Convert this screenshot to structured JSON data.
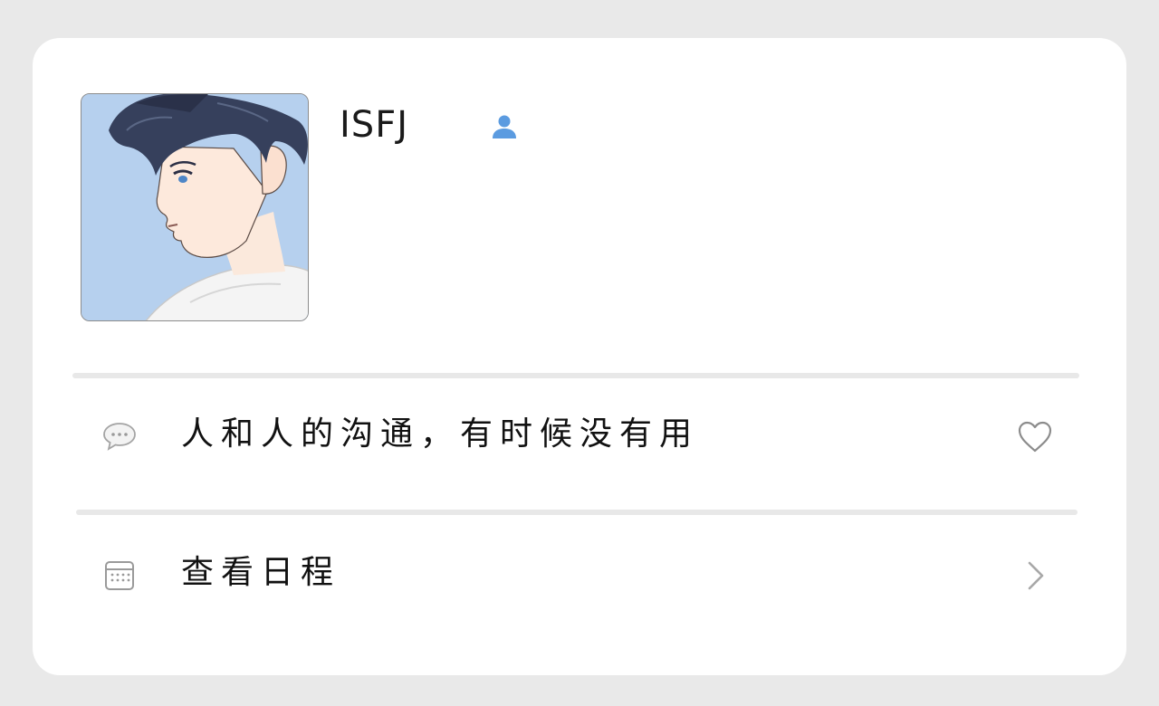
{
  "profile": {
    "name": "ISFJ",
    "avatar_icon": "anime-boy-avatar",
    "gender_icon": "person-icon",
    "accent_color": "#5b9be0"
  },
  "rows": [
    {
      "icon": "speech-bubble-icon",
      "text": "人和人的沟通，有时候没有用",
      "action_icon": "heart-outline-icon"
    },
    {
      "icon": "calendar-icon",
      "text": "查看日程",
      "action_icon": "chevron-right-icon"
    }
  ],
  "colors": {
    "background": "#e9e9e9",
    "card": "#ffffff",
    "divider": "#e8e8e8",
    "icon_gray": "#9a9a9a",
    "text": "#111111"
  }
}
